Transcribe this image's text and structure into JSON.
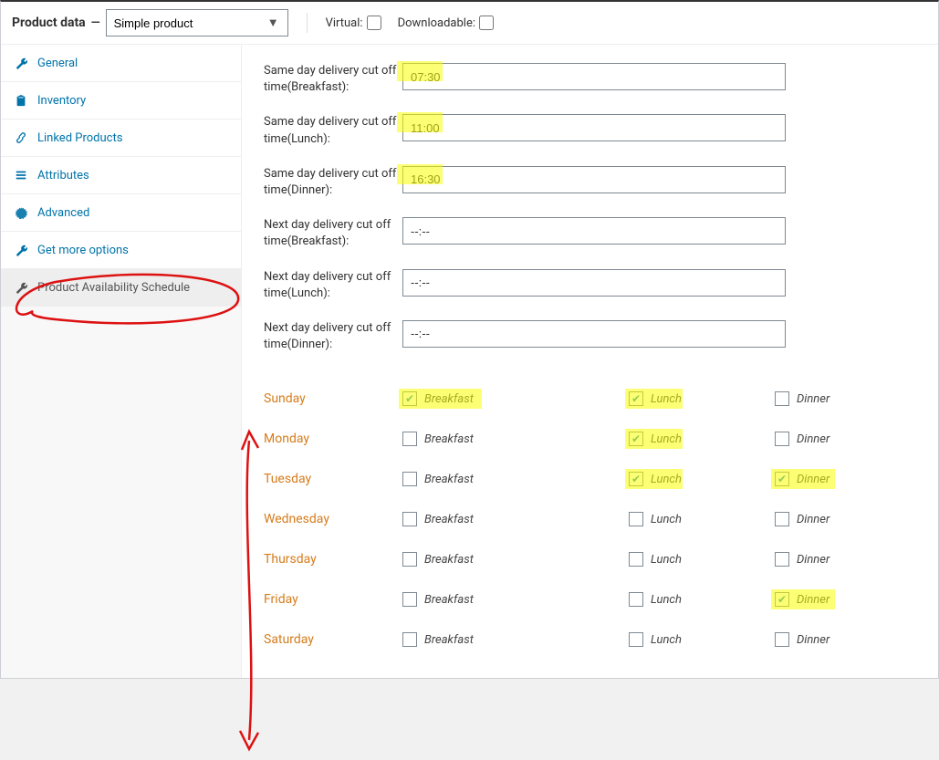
{
  "header": {
    "title": "Product data",
    "dash": "—",
    "product_type": "Simple product",
    "virtual_label": "Virtual:",
    "virtual_checked": false,
    "downloadable_label": "Downloadable:",
    "downloadable_checked": false
  },
  "sidebar": {
    "items": [
      {
        "id": "general",
        "label": "General",
        "icon": "wrench"
      },
      {
        "id": "inventory",
        "label": "Inventory",
        "icon": "clipboard"
      },
      {
        "id": "linked",
        "label": "Linked Products",
        "icon": "link"
      },
      {
        "id": "attributes",
        "label": "Attributes",
        "icon": "list"
      },
      {
        "id": "advanced",
        "label": "Advanced",
        "icon": "gear"
      },
      {
        "id": "getmore",
        "label": "Get more options",
        "icon": "wrench"
      },
      {
        "id": "schedule",
        "label": "Product Availability Schedule",
        "icon": "wrench",
        "active": true
      }
    ]
  },
  "cutoffs": [
    {
      "label": "Same day delivery cut off time(Breakfast):",
      "value": "07:30",
      "highlight": true
    },
    {
      "label": "Same day delivery cut off time(Lunch):",
      "value": "11:00",
      "highlight": true
    },
    {
      "label": "Same day delivery cut off time(Dinner):",
      "value": "16:30",
      "highlight": true
    },
    {
      "label": "Next day delivery cut off time(Breakfast):",
      "value": "--:--",
      "highlight": false
    },
    {
      "label": "Next day delivery cut off time(Lunch):",
      "value": "--:--",
      "highlight": false
    },
    {
      "label": "Next day delivery cut off time(Dinner):",
      "value": "--:--",
      "highlight": false
    }
  ],
  "meal_labels": {
    "breakfast": "Breakfast",
    "lunch": "Lunch",
    "dinner": "Dinner"
  },
  "days": [
    {
      "name": "Sunday",
      "breakfast": true,
      "breakfast_hl": true,
      "lunch": true,
      "lunch_hl": true,
      "dinner": false,
      "dinner_hl": false
    },
    {
      "name": "Monday",
      "breakfast": false,
      "breakfast_hl": false,
      "lunch": true,
      "lunch_hl": true,
      "dinner": false,
      "dinner_hl": false
    },
    {
      "name": "Tuesday",
      "breakfast": false,
      "breakfast_hl": false,
      "lunch": true,
      "lunch_hl": true,
      "dinner": true,
      "dinner_hl": true
    },
    {
      "name": "Wednesday",
      "breakfast": false,
      "breakfast_hl": false,
      "lunch": false,
      "lunch_hl": false,
      "dinner": false,
      "dinner_hl": false
    },
    {
      "name": "Thursday",
      "breakfast": false,
      "breakfast_hl": false,
      "lunch": false,
      "lunch_hl": false,
      "dinner": false,
      "dinner_hl": false
    },
    {
      "name": "Friday",
      "breakfast": false,
      "breakfast_hl": false,
      "lunch": false,
      "lunch_hl": false,
      "dinner": true,
      "dinner_hl": true
    },
    {
      "name": "Saturday",
      "breakfast": false,
      "breakfast_hl": false,
      "lunch": false,
      "lunch_hl": false,
      "dinner": false,
      "dinner_hl": false
    }
  ],
  "annotations": {
    "circle_sidebar_schedule": true,
    "vertical_arrow_days": true
  }
}
